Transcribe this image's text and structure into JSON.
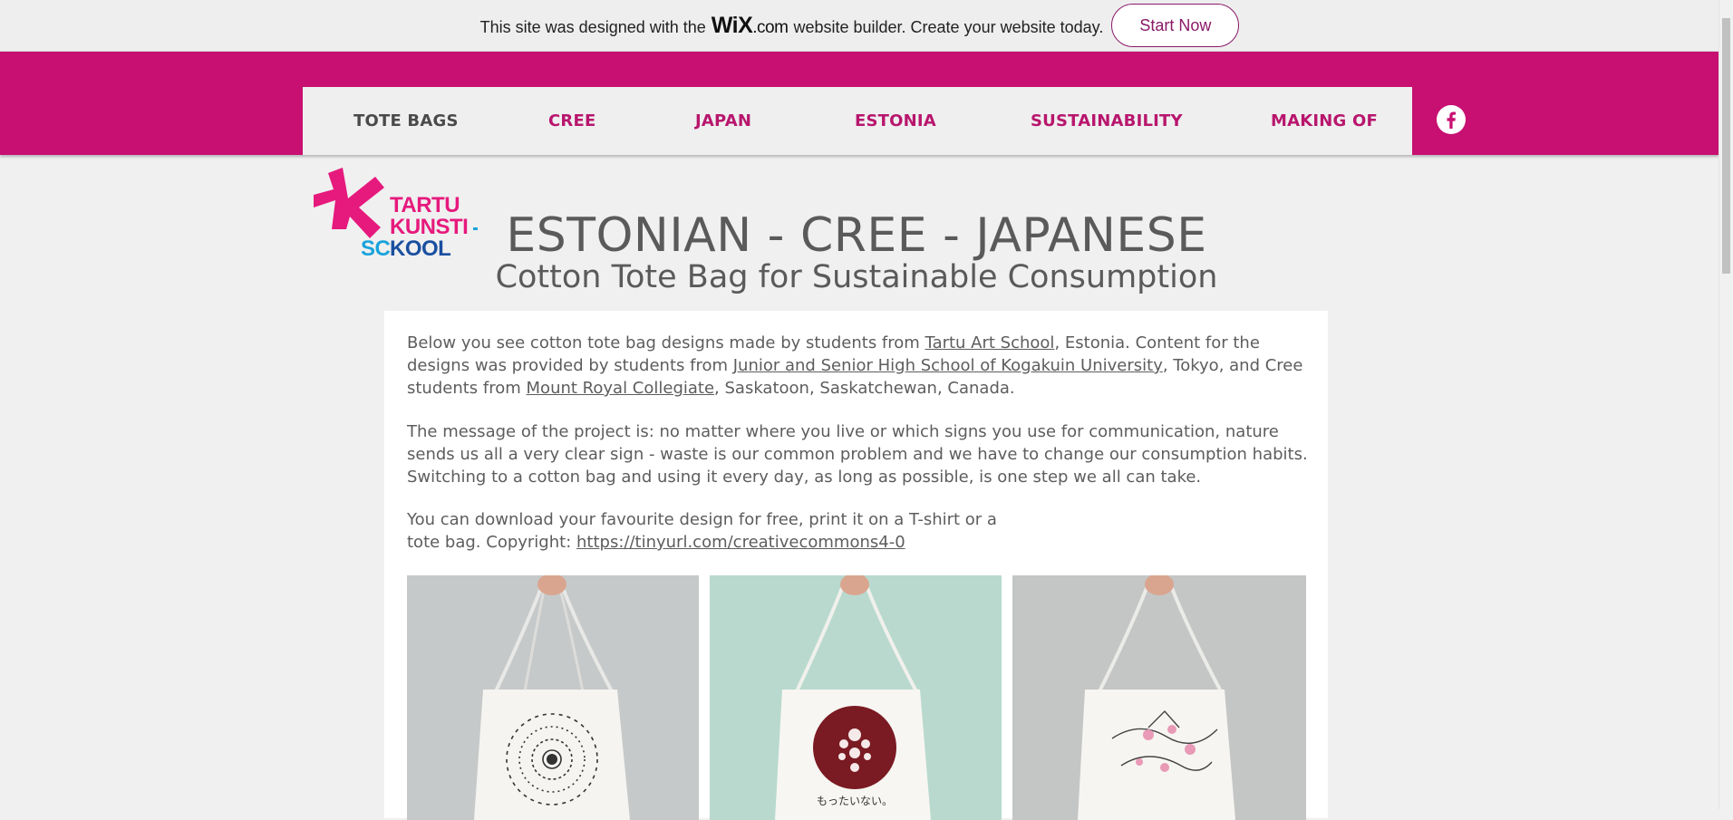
{
  "wix_banner": {
    "text_before": "This site was designed with the",
    "logo_main": "WiX",
    "logo_suffix": ".com",
    "text_after": "website builder. Create your website today.",
    "button_label": "Start Now"
  },
  "nav": {
    "items": [
      {
        "label": "TOTE BAGS",
        "active": true
      },
      {
        "label": "CREE",
        "active": false
      },
      {
        "label": "JAPAN",
        "active": false
      },
      {
        "label": "ESTONIA",
        "active": false
      },
      {
        "label": "SUSTAINABILITY",
        "active": false
      },
      {
        "label": "MAKING OF",
        "active": false
      }
    ],
    "social_icon": "facebook-icon"
  },
  "logo": {
    "line1": "TARTU",
    "line2": "KUNSTI",
    "line3": "KOOL",
    "line3_prefix": "SC"
  },
  "heading": {
    "title": "ESTONIAN - CREE - JAPANESE",
    "subtitle": "Cotton Tote Bag for Sustainable Consumption"
  },
  "intro": {
    "p1_a": "Below you see cotton tote bag designs made by students from ",
    "p1_link1": "Tartu Art School",
    "p1_b": ", Estonia. Content for the designs was provided by students from ",
    "p1_link2": "Junior and Senior High School of Kogakuin University",
    "p1_c": ", Tokyo, and Cree students from ",
    "p1_link3": "Mount Royal Collegiate",
    "p1_d": ", Saskatoon, Saskatchewan, Canada.",
    "p2": "The message of the project is: no matter where you live or which signs you use for communication, nature sends us all a very clear sign - waste is our common problem and we have to change our consumption habits. Switching to a cotton bag and using it every day, as long as possible, is one step we all can take.",
    "p3_a": "You can download your favourite design for free, print it on a T-shirt or a tote bag. Copyright: ",
    "p3_link": "https://tinyurl.com/creativecommons4-0"
  },
  "photos": {
    "bag2_text": "もったいない。"
  },
  "colors": {
    "brand_magenta": "#c80f72",
    "nav_text": "#b8166d",
    "logo_blue": "#1aa3dc"
  }
}
